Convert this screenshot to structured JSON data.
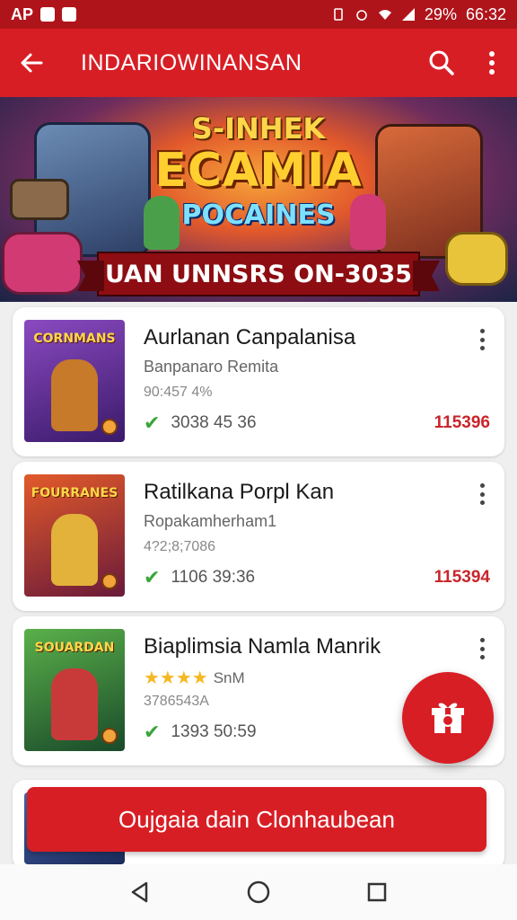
{
  "status_bar": {
    "left_text": "AP",
    "battery": "29%",
    "time": "66:32"
  },
  "app_bar": {
    "title": "INDARIOWINANSAN",
    "back_icon": "arrow-left-icon",
    "search_icon": "search-icon",
    "menu_icon": "more-vertical-icon"
  },
  "banner": {
    "line1": "S-INHEK",
    "line2": "ECAMIA",
    "line3": "POCAINES",
    "ribbon": "UAN UNNSRS ON-3035"
  },
  "items": [
    {
      "thumb_title": "CORNMANS",
      "name": "Aurlanan Canpalanisa",
      "subtitle": "Banpanaro Remita",
      "meta": "90:457 4%",
      "stat": "3038  45 36",
      "price": "115396",
      "thumb_bg": "#6a3a9a",
      "thumb_hero": "#c77a2a"
    },
    {
      "thumb_title": "FOURRANES",
      "name": "Ratilkana Porpl Kan",
      "subtitle": "Ropakamherham1",
      "meta": "4?2;8;7086",
      "stat": "1106  39:36",
      "price": "115394",
      "thumb_bg": "#a8303a",
      "thumb_hero": "#e2b23a"
    },
    {
      "thumb_title": "SOUARDAN",
      "name": "Biaplimsia Namla Manrik",
      "rating_stars": "★★★★",
      "rating_text": "SnM",
      "meta": "3786543A",
      "stat": "1393  50:59",
      "price": "",
      "thumb_bg": "#3a8a4a",
      "thumb_hero": "#c83a3a"
    }
  ],
  "fab": {
    "icon": "gift-icon"
  },
  "cta": {
    "label": "Oujgaia dain Clonhaubean"
  },
  "nav": {
    "back": "nav-back-icon",
    "home": "nav-home-icon",
    "recents": "nav-recents-icon"
  },
  "colors": {
    "primary": "#d81e25",
    "status": "#b0141b",
    "price": "#c8262c",
    "check": "#3aa53a",
    "star": "#f5b820"
  }
}
